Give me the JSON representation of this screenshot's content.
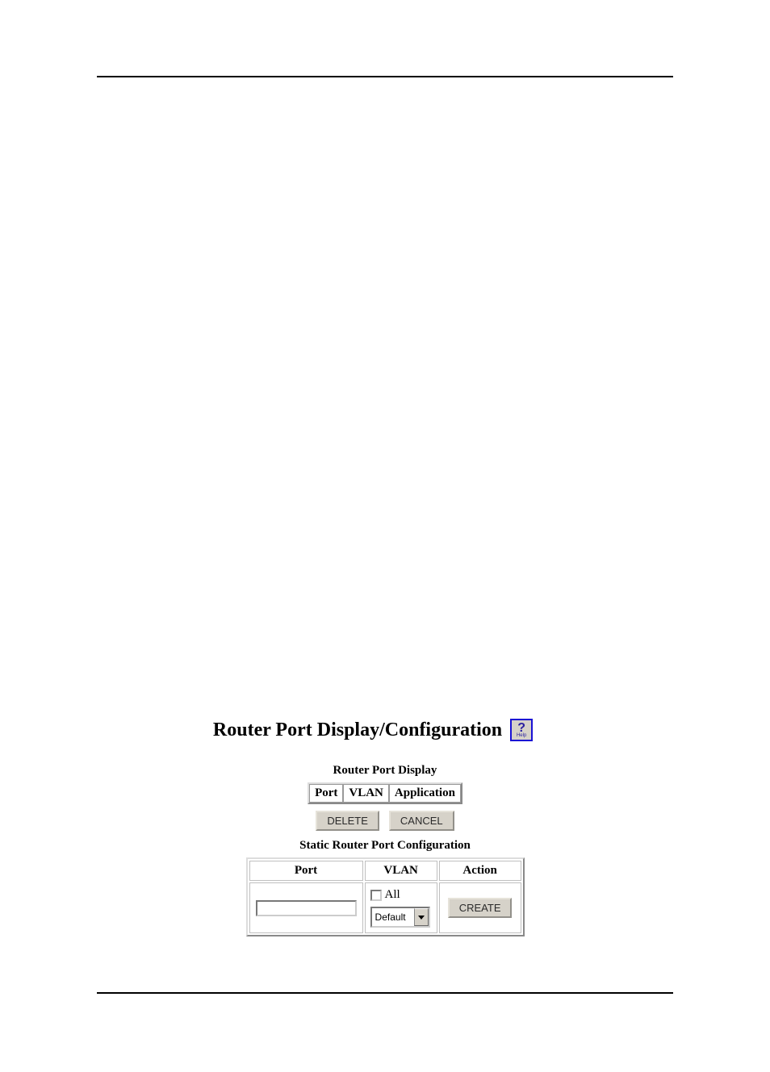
{
  "page_title": "Router Port Display/Configuration",
  "help": {
    "icon_text": "?",
    "label": "Help"
  },
  "display": {
    "title": "Router Port Display",
    "columns": [
      "Port",
      "VLAN",
      "Application"
    ],
    "buttons": {
      "delete": "DELETE",
      "cancel": "CANCEL"
    }
  },
  "config": {
    "title": "Static Router Port Configuration",
    "columns": {
      "port": "Port",
      "vlan": "VLAN",
      "action": "Action"
    },
    "port_value": "",
    "vlan_all_label": "All",
    "vlan_all_checked": false,
    "vlan_selected": "Default",
    "create_label": "CREATE"
  }
}
